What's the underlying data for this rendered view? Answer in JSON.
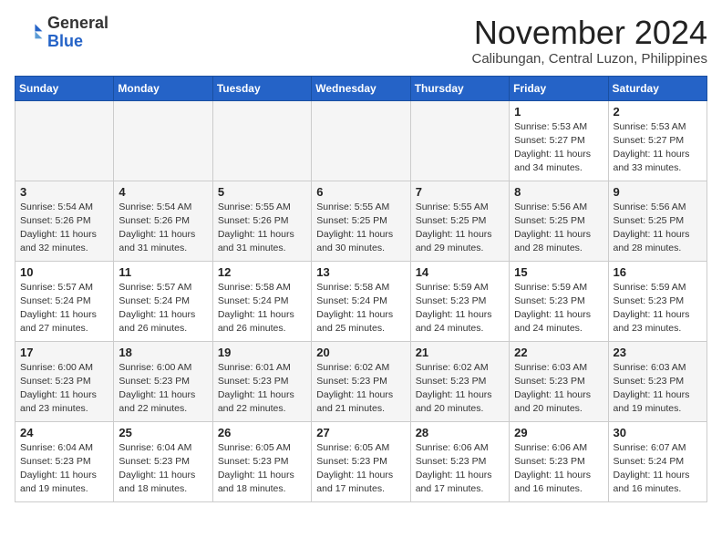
{
  "logo": {
    "general": "General",
    "blue": "Blue"
  },
  "header": {
    "month": "November 2024",
    "location": "Calibungan, Central Luzon, Philippines"
  },
  "weekdays": [
    "Sunday",
    "Monday",
    "Tuesday",
    "Wednesday",
    "Thursday",
    "Friday",
    "Saturday"
  ],
  "weeks": [
    [
      {
        "day": "",
        "info": ""
      },
      {
        "day": "",
        "info": ""
      },
      {
        "day": "",
        "info": ""
      },
      {
        "day": "",
        "info": ""
      },
      {
        "day": "",
        "info": ""
      },
      {
        "day": "1",
        "info": "Sunrise: 5:53 AM\nSunset: 5:27 PM\nDaylight: 11 hours and 34 minutes."
      },
      {
        "day": "2",
        "info": "Sunrise: 5:53 AM\nSunset: 5:27 PM\nDaylight: 11 hours and 33 minutes."
      }
    ],
    [
      {
        "day": "3",
        "info": "Sunrise: 5:54 AM\nSunset: 5:26 PM\nDaylight: 11 hours and 32 minutes."
      },
      {
        "day": "4",
        "info": "Sunrise: 5:54 AM\nSunset: 5:26 PM\nDaylight: 11 hours and 31 minutes."
      },
      {
        "day": "5",
        "info": "Sunrise: 5:55 AM\nSunset: 5:26 PM\nDaylight: 11 hours and 31 minutes."
      },
      {
        "day": "6",
        "info": "Sunrise: 5:55 AM\nSunset: 5:25 PM\nDaylight: 11 hours and 30 minutes."
      },
      {
        "day": "7",
        "info": "Sunrise: 5:55 AM\nSunset: 5:25 PM\nDaylight: 11 hours and 29 minutes."
      },
      {
        "day": "8",
        "info": "Sunrise: 5:56 AM\nSunset: 5:25 PM\nDaylight: 11 hours and 28 minutes."
      },
      {
        "day": "9",
        "info": "Sunrise: 5:56 AM\nSunset: 5:25 PM\nDaylight: 11 hours and 28 minutes."
      }
    ],
    [
      {
        "day": "10",
        "info": "Sunrise: 5:57 AM\nSunset: 5:24 PM\nDaylight: 11 hours and 27 minutes."
      },
      {
        "day": "11",
        "info": "Sunrise: 5:57 AM\nSunset: 5:24 PM\nDaylight: 11 hours and 26 minutes."
      },
      {
        "day": "12",
        "info": "Sunrise: 5:58 AM\nSunset: 5:24 PM\nDaylight: 11 hours and 26 minutes."
      },
      {
        "day": "13",
        "info": "Sunrise: 5:58 AM\nSunset: 5:24 PM\nDaylight: 11 hours and 25 minutes."
      },
      {
        "day": "14",
        "info": "Sunrise: 5:59 AM\nSunset: 5:23 PM\nDaylight: 11 hours and 24 minutes."
      },
      {
        "day": "15",
        "info": "Sunrise: 5:59 AM\nSunset: 5:23 PM\nDaylight: 11 hours and 24 minutes."
      },
      {
        "day": "16",
        "info": "Sunrise: 5:59 AM\nSunset: 5:23 PM\nDaylight: 11 hours and 23 minutes."
      }
    ],
    [
      {
        "day": "17",
        "info": "Sunrise: 6:00 AM\nSunset: 5:23 PM\nDaylight: 11 hours and 23 minutes."
      },
      {
        "day": "18",
        "info": "Sunrise: 6:00 AM\nSunset: 5:23 PM\nDaylight: 11 hours and 22 minutes."
      },
      {
        "day": "19",
        "info": "Sunrise: 6:01 AM\nSunset: 5:23 PM\nDaylight: 11 hours and 22 minutes."
      },
      {
        "day": "20",
        "info": "Sunrise: 6:02 AM\nSunset: 5:23 PM\nDaylight: 11 hours and 21 minutes."
      },
      {
        "day": "21",
        "info": "Sunrise: 6:02 AM\nSunset: 5:23 PM\nDaylight: 11 hours and 20 minutes."
      },
      {
        "day": "22",
        "info": "Sunrise: 6:03 AM\nSunset: 5:23 PM\nDaylight: 11 hours and 20 minutes."
      },
      {
        "day": "23",
        "info": "Sunrise: 6:03 AM\nSunset: 5:23 PM\nDaylight: 11 hours and 19 minutes."
      }
    ],
    [
      {
        "day": "24",
        "info": "Sunrise: 6:04 AM\nSunset: 5:23 PM\nDaylight: 11 hours and 19 minutes."
      },
      {
        "day": "25",
        "info": "Sunrise: 6:04 AM\nSunset: 5:23 PM\nDaylight: 11 hours and 18 minutes."
      },
      {
        "day": "26",
        "info": "Sunrise: 6:05 AM\nSunset: 5:23 PM\nDaylight: 11 hours and 18 minutes."
      },
      {
        "day": "27",
        "info": "Sunrise: 6:05 AM\nSunset: 5:23 PM\nDaylight: 11 hours and 17 minutes."
      },
      {
        "day": "28",
        "info": "Sunrise: 6:06 AM\nSunset: 5:23 PM\nDaylight: 11 hours and 17 minutes."
      },
      {
        "day": "29",
        "info": "Sunrise: 6:06 AM\nSunset: 5:23 PM\nDaylight: 11 hours and 16 minutes."
      },
      {
        "day": "30",
        "info": "Sunrise: 6:07 AM\nSunset: 5:24 PM\nDaylight: 11 hours and 16 minutes."
      }
    ]
  ]
}
